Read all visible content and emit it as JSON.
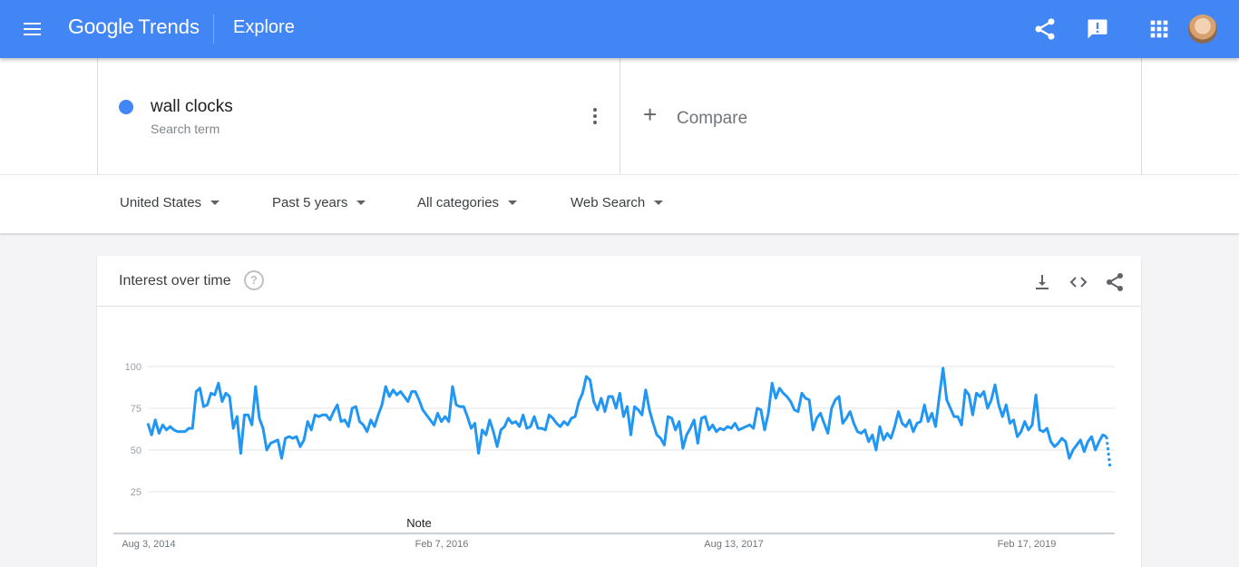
{
  "header": {
    "brand_google": "Google",
    "brand_trends": "Trends",
    "page_title": "Explore",
    "accent_color": "#4285f4",
    "icons": [
      "menu-icon",
      "share-icon",
      "feedback-icon",
      "apps-icon",
      "avatar"
    ]
  },
  "search_term": {
    "name": "wall clocks",
    "subtitle": "Search term",
    "color": "#4285f4"
  },
  "compare": {
    "label": "Compare"
  },
  "filters": [
    {
      "label": "United States"
    },
    {
      "label": "Past 5 years"
    },
    {
      "label": "All categories"
    },
    {
      "label": "Web Search"
    }
  ],
  "card": {
    "title": "Interest over time",
    "help_glyph": "?",
    "icons": [
      "download-icon",
      "embed-icon",
      "share-icon"
    ]
  },
  "chart_data": {
    "type": "line",
    "x_tick_labels": [
      "Aug 3, 2014",
      "Feb 7, 2016",
      "Aug 13, 2017",
      "Feb 17, 2019"
    ],
    "y_ticks": [
      25,
      50,
      75,
      100
    ],
    "ylim": [
      0,
      100
    ],
    "annotation": "Note",
    "legend": "none",
    "grid": true,
    "series": [
      {
        "color": "#2196f3",
        "values": [
          66,
          59,
          68,
          60,
          65,
          62,
          64,
          62,
          61,
          61,
          61,
          63,
          63,
          85,
          87,
          76,
          77,
          84,
          83,
          90,
          79,
          84,
          82,
          63,
          70,
          48,
          71,
          71,
          65,
          88,
          69,
          63,
          50,
          54,
          55,
          56,
          45,
          57,
          58,
          57,
          58,
          52,
          56,
          67,
          62,
          71,
          70,
          71,
          71,
          68,
          73,
          77,
          67,
          68,
          64,
          75,
          76,
          67,
          65,
          61,
          68,
          64,
          71,
          77,
          88,
          82,
          86,
          83,
          85,
          82,
          79,
          85,
          85,
          80,
          74,
          71,
          68,
          65,
          72,
          67,
          70,
          67,
          88,
          77,
          76,
          76,
          70,
          63,
          66,
          48,
          62,
          59,
          68,
          61,
          52,
          62,
          64,
          69,
          66,
          67,
          64,
          71,
          63,
          64,
          70,
          63,
          63,
          62,
          71,
          69,
          66,
          64,
          67,
          65,
          69,
          70,
          79,
          84,
          94,
          92,
          79,
          74,
          81,
          73,
          82,
          82,
          75,
          84,
          70,
          76,
          59,
          76,
          74,
          71,
          86,
          74,
          66,
          59,
          57,
          53,
          70,
          69,
          62,
          67,
          51,
          59,
          63,
          68,
          54,
          69,
          70,
          62,
          65,
          61,
          63,
          62,
          64,
          63,
          66,
          62,
          63,
          64,
          65,
          63,
          75,
          74,
          62,
          72,
          90,
          81,
          87,
          84,
          82,
          79,
          74,
          73,
          84,
          81,
          80,
          62,
          69,
          72,
          66,
          60,
          75,
          80,
          82,
          66,
          69,
          73,
          66,
          61,
          60,
          62,
          55,
          59,
          50,
          64,
          56,
          60,
          57,
          64,
          73,
          66,
          64,
          68,
          61,
          66,
          67,
          77,
          67,
          72,
          64,
          82,
          99,
          80,
          75,
          70,
          70,
          65,
          86,
          83,
          71,
          84,
          82,
          85,
          75,
          80,
          89,
          77,
          70,
          77,
          66,
          68,
          58,
          61,
          67,
          62,
          65,
          83,
          62,
          61,
          63,
          55,
          52,
          54,
          57,
          55,
          45,
          50,
          53,
          56,
          49,
          55,
          58,
          50,
          55,
          59,
          58,
          39
        ]
      }
    ]
  }
}
